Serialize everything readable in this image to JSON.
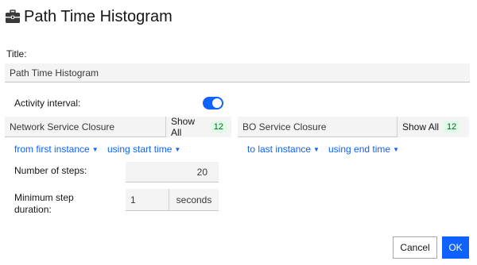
{
  "dialog": {
    "title": "Path Time Histogram",
    "icon": "briefcase-icon"
  },
  "title_field": {
    "label": "Title:",
    "value": "Path Time Histogram"
  },
  "activity": {
    "label": "Activity interval:",
    "toggle_on": true
  },
  "start_service": {
    "name": "Network Service Closure",
    "show_all_label": "Show All",
    "count": "12",
    "from_prefix": "from ",
    "from_value": "first instance",
    "using_prefix": "using ",
    "using_value": "start time"
  },
  "end_service": {
    "name": "BO Service Closure",
    "show_all_label": "Show All",
    "count": "12",
    "to_prefix": "to ",
    "to_value": "last instance",
    "using_prefix": "using ",
    "using_value": "end time"
  },
  "steps": {
    "label": "Number of steps:",
    "value": "20"
  },
  "duration": {
    "label": "Minimum step duration:",
    "value": "1",
    "unit": "seconds"
  },
  "buttons": {
    "cancel": "Cancel",
    "ok": "OK"
  },
  "colors": {
    "accent": "#0f62fe",
    "field_bg": "#f4f4f4",
    "count_badge_bg": "#defbe6"
  }
}
